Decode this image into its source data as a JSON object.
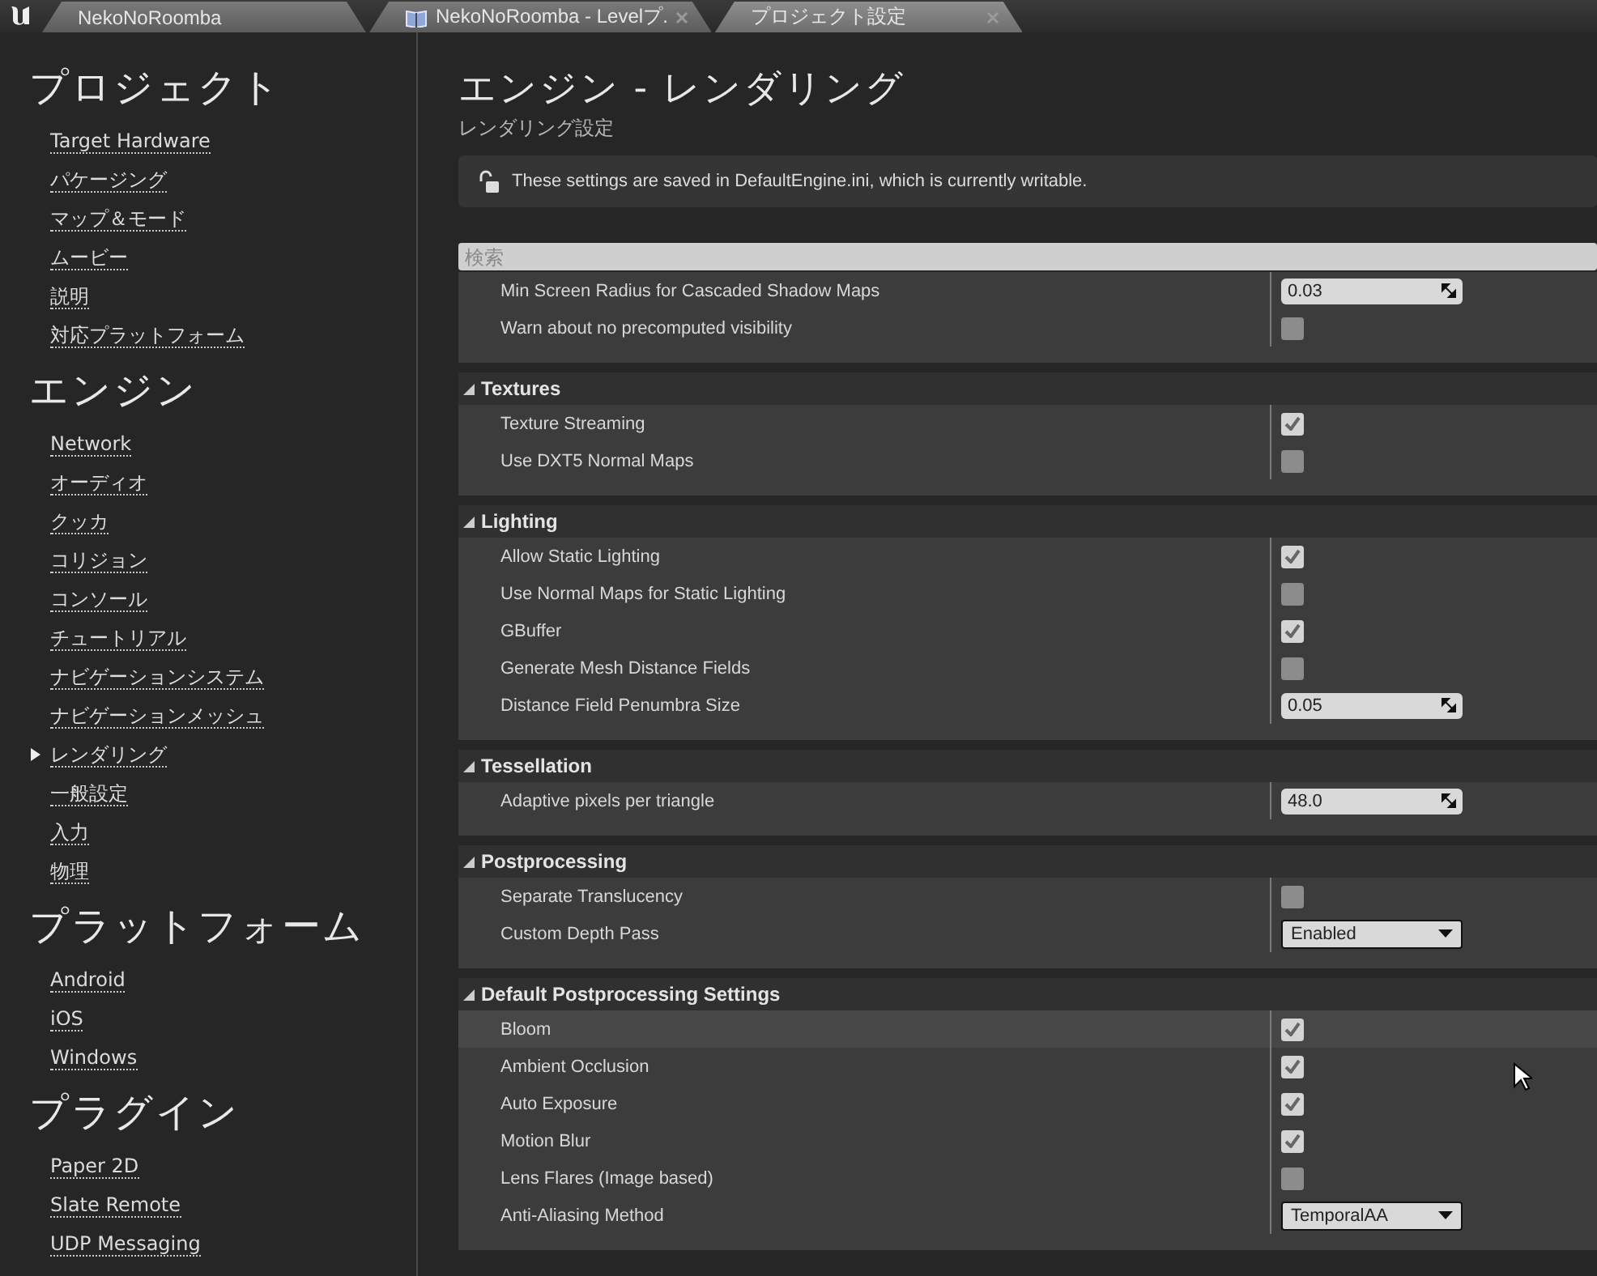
{
  "tabs": [
    {
      "label": "NekoNoRoomba",
      "selected": false,
      "closable": false,
      "icon": false
    },
    {
      "label": "NekoNoRoomba - Levelプ.",
      "selected": false,
      "closable": true,
      "icon": true
    },
    {
      "label": "プロジェクト設定",
      "selected": true,
      "closable": true,
      "icon": false
    }
  ],
  "sidebar": {
    "sections": [
      {
        "title": "プロジェクト",
        "items": [
          {
            "label": "Target Hardware",
            "selected": false
          },
          {
            "label": "パケージング",
            "selected": false
          },
          {
            "label": "マップ＆モード",
            "selected": false
          },
          {
            "label": "ムービー",
            "selected": false
          },
          {
            "label": "説明",
            "selected": false
          },
          {
            "label": "対応プラットフォーム",
            "selected": false
          }
        ]
      },
      {
        "title": "エンジン",
        "items": [
          {
            "label": "Network",
            "selected": false
          },
          {
            "label": "オーディオ",
            "selected": false
          },
          {
            "label": "クッカ",
            "selected": false
          },
          {
            "label": "コリジョン",
            "selected": false
          },
          {
            "label": "コンソール",
            "selected": false
          },
          {
            "label": "チュートリアル",
            "selected": false
          },
          {
            "label": "ナビゲーションシステム",
            "selected": false
          },
          {
            "label": "ナビゲーションメッシュ",
            "selected": false
          },
          {
            "label": "レンダリング",
            "selected": true
          },
          {
            "label": "一般設定",
            "selected": false
          },
          {
            "label": "入力",
            "selected": false
          },
          {
            "label": "物理",
            "selected": false
          }
        ]
      },
      {
        "title": "プラットフォーム",
        "items": [
          {
            "label": "Android",
            "selected": false
          },
          {
            "label": "iOS",
            "selected": false
          },
          {
            "label": "Windows",
            "selected": false
          }
        ]
      },
      {
        "title": "プラグイン",
        "items": [
          {
            "label": "Paper 2D",
            "selected": false
          },
          {
            "label": "Slate Remote",
            "selected": false
          },
          {
            "label": "UDP Messaging",
            "selected": false
          }
        ]
      }
    ]
  },
  "page": {
    "title": "エンジン - レンダリング",
    "subtitle": "レンダリング設定",
    "notice": "These settings are saved in DefaultEngine.ini, which is currently writable.",
    "search": {
      "placeholder": "検索"
    }
  },
  "groups": [
    {
      "rows": [
        {
          "kind": "number",
          "label": "Min Screen Radius for Cascaded Shadow Maps",
          "value": "0.03"
        },
        {
          "kind": "checkbox",
          "label": "Warn about no precomputed visibility",
          "checked": false
        }
      ]
    },
    {
      "title": "Textures",
      "rows": [
        {
          "kind": "checkbox",
          "label": "Texture Streaming",
          "checked": true
        },
        {
          "kind": "checkbox",
          "label": "Use DXT5 Normal Maps",
          "checked": false
        }
      ]
    },
    {
      "title": "Lighting",
      "rows": [
        {
          "kind": "checkbox",
          "label": "Allow Static Lighting",
          "checked": true
        },
        {
          "kind": "checkbox",
          "label": "Use Normal Maps for Static Lighting",
          "checked": false
        },
        {
          "kind": "checkbox",
          "label": "GBuffer",
          "checked": true
        },
        {
          "kind": "checkbox",
          "label": "Generate Mesh Distance Fields",
          "checked": false
        },
        {
          "kind": "number",
          "label": "Distance Field Penumbra Size",
          "value": "0.05"
        }
      ]
    },
    {
      "title": "Tessellation",
      "rows": [
        {
          "kind": "number",
          "label": "Adaptive pixels per triangle",
          "value": "48.0"
        }
      ]
    },
    {
      "title": "Postprocessing",
      "rows": [
        {
          "kind": "checkbox",
          "label": "Separate Translucency",
          "checked": false
        },
        {
          "kind": "dropdown",
          "label": "Custom Depth Pass",
          "value": "Enabled"
        }
      ]
    },
    {
      "title": "Default Postprocessing Settings",
      "rows": [
        {
          "kind": "checkbox",
          "label": "Bloom",
          "checked": true,
          "hovered": true
        },
        {
          "kind": "checkbox",
          "label": "Ambient Occlusion",
          "checked": true
        },
        {
          "kind": "checkbox",
          "label": "Auto Exposure",
          "checked": true
        },
        {
          "kind": "checkbox",
          "label": "Motion Blur",
          "checked": true
        },
        {
          "kind": "checkbox",
          "label": "Lens Flares (Image based)",
          "checked": false
        },
        {
          "kind": "dropdown",
          "label": "Anti-Aliasing Method",
          "value": "TemporalAA"
        }
      ]
    }
  ]
}
